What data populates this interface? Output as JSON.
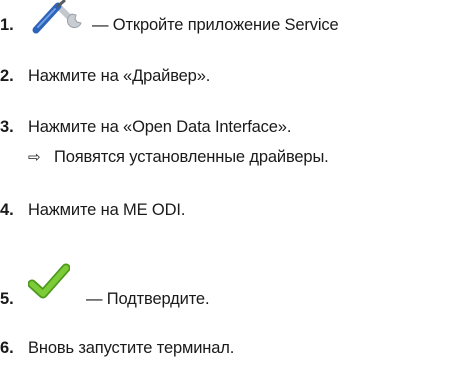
{
  "steps": [
    {
      "number": "1.",
      "text": "— Откройте приложение Service",
      "icon": "wrench-icon"
    },
    {
      "number": "2.",
      "text": "Нажмите на «Драйвер»."
    },
    {
      "number": "3.",
      "text": "Нажмите на «Open Data Interface».",
      "result_arrow": "⇨",
      "result": "Появятся установленные драйверы."
    },
    {
      "number": "4.",
      "text": "Нажмите на ME ODI."
    },
    {
      "number": "5.",
      "text": "— Подтвердите.",
      "icon": "checkmark-icon"
    },
    {
      "number": "6.",
      "text": "Вновь запустите терминал."
    }
  ],
  "colors": {
    "wrench_blue": "#2f6fc4",
    "wrench_gray": "#b8bcc4",
    "check_green": "#6bbf2a"
  }
}
